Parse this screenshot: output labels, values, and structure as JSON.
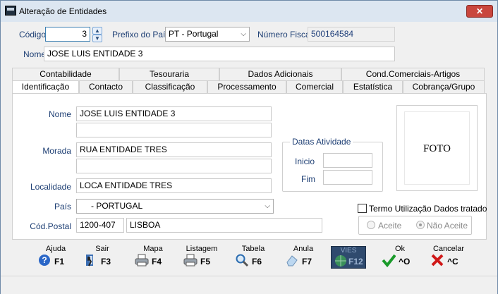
{
  "window": {
    "title": "Alteração de Entidades",
    "close": "✕"
  },
  "header": {
    "codigo_label": "Código",
    "codigo_value": "3",
    "prefixo_label": "Prefixo do País",
    "prefixo_value": "PT - Portugal",
    "nif_label": "Número Fiscal",
    "nif_value": "500164584",
    "nome_label": "Nome",
    "nome_value": "JOSE LUIS ENTIDADE 3"
  },
  "tabs_top": [
    "Contabilidade",
    "Tesouraria",
    "Dados Adicionais",
    "Cond.Comerciais-Artigos"
  ],
  "tabs_bottom": [
    "Identificação",
    "Contacto",
    "Classificação",
    "Processamento",
    "Comercial",
    "Estatística",
    "Cobrança/Grupo"
  ],
  "form": {
    "nome_label": "Nome",
    "nome1": "JOSE LUIS ENTIDADE 3",
    "nome2": "",
    "morada_label": "Morada",
    "morada1": "RUA ENTIDADE TRES",
    "morada2": "",
    "localidade_label": "Localidade",
    "localidade": "LOCA ENTIDADE TRES",
    "pais_label": "País",
    "pais": "- PORTUGAL",
    "codpostal_label": "Cód.Postal",
    "codpostal": "1200-407",
    "cidade": "LISBOA"
  },
  "datas": {
    "title": "Datas Atividade",
    "inicio_label": "Inicio",
    "inicio": "",
    "fim_label": "Fim",
    "fim": ""
  },
  "foto": "FOTO",
  "termo": {
    "label": "Termo Utilização Dados tratado",
    "aceite": "Aceite",
    "nao_aceite": "Não Aceite"
  },
  "buttons": [
    {
      "top": "Ajuda",
      "key": "F1",
      "icon": "help-icon"
    },
    {
      "top": "Sair",
      "key": "F3",
      "icon": "exit-icon"
    },
    {
      "top": "Mapa",
      "key": "F4",
      "icon": "printer-icon"
    },
    {
      "top": "Listagem",
      "key": "F5",
      "icon": "printer-icon"
    },
    {
      "top": "Tabela",
      "key": "F6",
      "icon": "magnifier-icon"
    },
    {
      "top": "Anula",
      "key": "F7",
      "icon": "eraser-icon"
    },
    {
      "top": "VIES",
      "key": "F12",
      "icon": "globe-icon"
    },
    {
      "top": "Ok",
      "key": "^O",
      "icon": "check-icon"
    },
    {
      "top": "Cancelar",
      "key": "^C",
      "icon": "cross-icon"
    }
  ]
}
